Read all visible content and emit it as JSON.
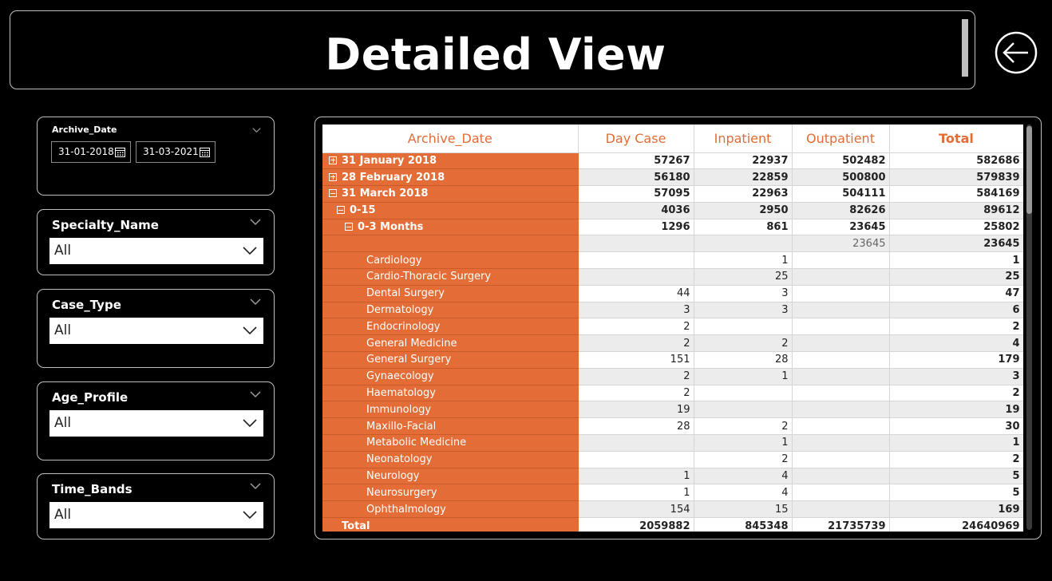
{
  "header": {
    "title": "Detailed View",
    "back_icon": "back-arrow-icon"
  },
  "slicers": {
    "archive_date": {
      "title": "Archive_Date",
      "start": "31-01-2018",
      "end": "31-03-2021"
    },
    "specialty": {
      "title": "Specialty_Name",
      "value": "All"
    },
    "case_type": {
      "title": "Case_Type",
      "value": "All"
    },
    "age_profile": {
      "title": "Age_Profile",
      "value": "All"
    },
    "time_bands": {
      "title": "Time_Bands",
      "value": "All"
    }
  },
  "table": {
    "columns": [
      "Archive_Date",
      "Day Case",
      "Inpatient",
      "Outpatient",
      "Total"
    ],
    "rows": [
      {
        "label": "31 January 2018",
        "level": 0,
        "expand": "plus",
        "bold": true,
        "values": [
          "57267",
          "22937",
          "502482",
          "582686"
        ]
      },
      {
        "label": "28 February 2018",
        "level": 0,
        "expand": "plus",
        "bold": true,
        "values": [
          "56180",
          "22859",
          "500800",
          "579839"
        ]
      },
      {
        "label": "31 March 2018",
        "level": 0,
        "expand": "minus",
        "bold": true,
        "values": [
          "57095",
          "22963",
          "504111",
          "584169"
        ]
      },
      {
        "label": "0-15",
        "level": 1,
        "expand": "minus",
        "bold": true,
        "values": [
          "4036",
          "2950",
          "82626",
          "89612"
        ]
      },
      {
        "label": "0-3 Months",
        "level": 2,
        "expand": "minus",
        "bold": true,
        "values": [
          "1296",
          "861",
          "23645",
          "25802"
        ]
      },
      {
        "label": "",
        "level": 3,
        "expand": "",
        "bold": false,
        "values": [
          "",
          "",
          "23645",
          "23645"
        ]
      },
      {
        "label": "Cardiology",
        "level": 3,
        "expand": "",
        "bold": false,
        "values": [
          "",
          "1",
          "",
          "1"
        ]
      },
      {
        "label": "Cardio-Thoracic Surgery",
        "level": 3,
        "expand": "",
        "bold": false,
        "values": [
          "",
          "25",
          "",
          "25"
        ]
      },
      {
        "label": "Dental Surgery",
        "level": 3,
        "expand": "",
        "bold": false,
        "values": [
          "44",
          "3",
          "",
          "47"
        ]
      },
      {
        "label": "Dermatology",
        "level": 3,
        "expand": "",
        "bold": false,
        "values": [
          "3",
          "3",
          "",
          "6"
        ]
      },
      {
        "label": "Endocrinology",
        "level": 3,
        "expand": "",
        "bold": false,
        "values": [
          "2",
          "",
          "",
          "2"
        ]
      },
      {
        "label": "General Medicine",
        "level": 3,
        "expand": "",
        "bold": false,
        "values": [
          "2",
          "2",
          "",
          "4"
        ]
      },
      {
        "label": "General Surgery",
        "level": 3,
        "expand": "",
        "bold": false,
        "values": [
          "151",
          "28",
          "",
          "179"
        ]
      },
      {
        "label": "Gynaecology",
        "level": 3,
        "expand": "",
        "bold": false,
        "values": [
          "2",
          "1",
          "",
          "3"
        ]
      },
      {
        "label": "Haematology",
        "level": 3,
        "expand": "",
        "bold": false,
        "values": [
          "2",
          "",
          "",
          "2"
        ]
      },
      {
        "label": "Immunology",
        "level": 3,
        "expand": "",
        "bold": false,
        "values": [
          "19",
          "",
          "",
          "19"
        ]
      },
      {
        "label": "Maxillo-Facial",
        "level": 3,
        "expand": "",
        "bold": false,
        "values": [
          "28",
          "2",
          "",
          "30"
        ]
      },
      {
        "label": "Metabolic Medicine",
        "level": 3,
        "expand": "",
        "bold": false,
        "values": [
          "",
          "1",
          "",
          "1"
        ]
      },
      {
        "label": "Neonatology",
        "level": 3,
        "expand": "",
        "bold": false,
        "values": [
          "",
          "2",
          "",
          "2"
        ]
      },
      {
        "label": "Neurology",
        "level": 3,
        "expand": "",
        "bold": false,
        "values": [
          "1",
          "4",
          "",
          "5"
        ]
      },
      {
        "label": "Neurosurgery",
        "level": 3,
        "expand": "",
        "bold": false,
        "values": [
          "1",
          "4",
          "",
          "5"
        ]
      },
      {
        "label": "Ophthalmology",
        "level": 3,
        "expand": "",
        "bold": false,
        "values": [
          "154",
          "15",
          "",
          "169"
        ]
      }
    ],
    "total": {
      "label": "Total",
      "values": [
        "2059882",
        "845348",
        "21735739",
        "24640969"
      ]
    }
  },
  "colors": {
    "accent": "#e46c36",
    "background": "#000000",
    "border": "#bfbfbf"
  }
}
